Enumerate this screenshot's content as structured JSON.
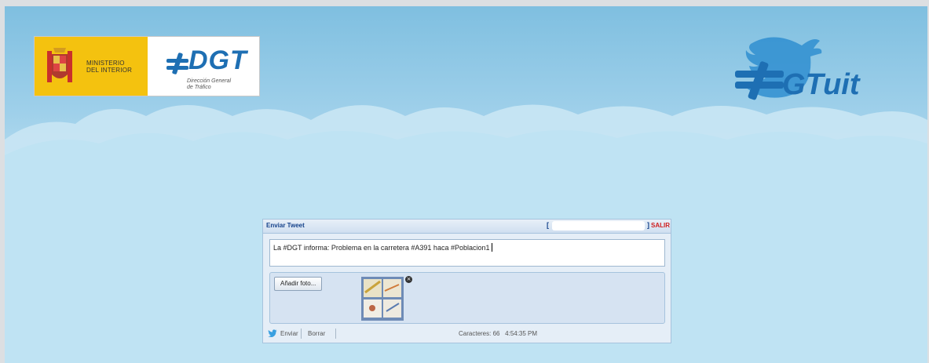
{
  "header": {
    "ministerio_line1": "MINISTERIO",
    "ministerio_line2": "DEL INTERIOR",
    "dgt_logo": "DGT",
    "dgt_sub1": "Dirección General",
    "dgt_sub2": "de Tráfico",
    "app_logo": "DGTuit"
  },
  "panel": {
    "title": "Enviar Tweet",
    "bracket_open": "[",
    "bracket_close": "]",
    "logout_label": "SALIR",
    "tweet_text": "La #DGT informa: Problema en la carretera #A391 haca #Poblacion1",
    "add_photo_label": "Añadir foto...",
    "thumb_close": "×",
    "send_label": "Enviar",
    "clear_label": "Borrar",
    "char_count": "Caracteres: 66",
    "time": "4:54:35 PM"
  },
  "colors": {
    "sky": "#9fd0ea",
    "brand_blue": "#1e6fb3",
    "panel_title": "#15428b",
    "logout_red": "#d01f1f",
    "ministerio_yellow": "#f4c20f"
  }
}
